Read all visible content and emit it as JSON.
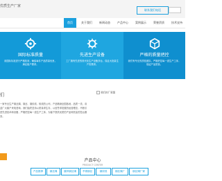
{
  "header": {
    "brand": "优质生产厂家",
    "hotline_label": "联系我们电话"
  },
  "nav": {
    "items": [
      {
        "label": "首页"
      },
      {
        "label": "关于我们"
      },
      {
        "label": "新闻动态"
      },
      {
        "label": "产品中心"
      },
      {
        "label": "案例展示"
      },
      {
        "label": "荣誉资质"
      },
      {
        "label": "技术支持"
      }
    ]
  },
  "features": [
    {
      "title": "国际标准质量",
      "desc": "用国际标准进行严格检测，确保每件产品质量优良，满足客户需求。"
    },
    {
      "title": "先进生产设备",
      "desc": "工厂拥有先进的现代化生产设备多台，保证大批量生产的需求。"
    },
    {
      "title": "严格的质量把控",
      "desc": "我们有专业的质检团队，严格把控每一道生产工序，保证产品质量。"
    }
  ],
  "about": {
    "title": "们",
    "image_caption": "我们的厂家图",
    "paragraph": "一家专业生产钢丝绳、钢丝、钢绞线、软线的公司，产品畅销全国各地，品质一流，欢迎广大客户来电咨询。我们始终坚持以质量求生存，以信誉求发展的经营理念，不断引进先进技术和设备，严格把控每一道生产工序，为客户提供优质的产品和完善的售后服务。"
  },
  "products": {
    "title": "产品中心",
    "subtitle": "PRODUCT CENTER",
    "tabs": [
      {
        "label": "产品推荐"
      },
      {
        "label": "钢丝绳"
      },
      {
        "label": "镀锌钢丝绳"
      },
      {
        "label": "不锈钢丝"
      },
      {
        "label": "钢绞线"
      },
      {
        "label": "钢丝绳厂"
      },
      {
        "label": "钢丝绳厂家"
      }
    ]
  },
  "colors": {
    "accent": "#1aa0de",
    "feature_bg_1": "#139ad8",
    "feature_bg_2": "#1fa6e0",
    "feature_bg_3": "#0f8fcf",
    "more_button": "#f29a1b"
  }
}
